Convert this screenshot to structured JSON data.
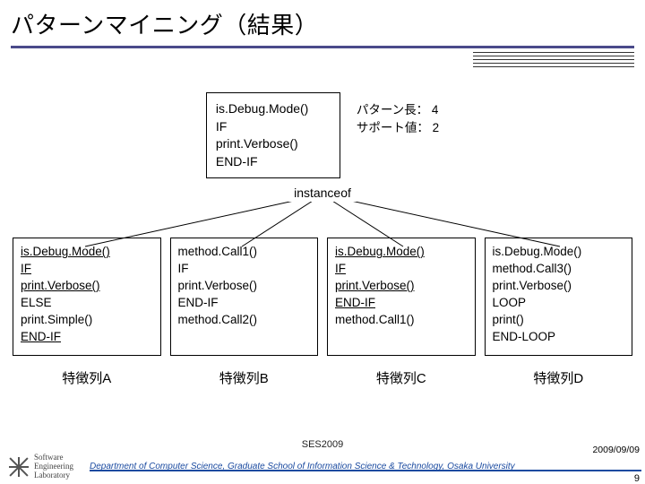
{
  "title": "パターンマイニング（結果）",
  "pattern_box": {
    "l1": "is.Debug.Mode()",
    "l2": "IF",
    "l3": "print.Verbose()",
    "l4": "END-IF"
  },
  "pattern_meta": {
    "line1": "パターン長： 4",
    "line2": "サポート値： 2"
  },
  "instanceof_label": "instanceof",
  "cols": {
    "A": {
      "label": "特徴列A",
      "l1": "is.Debug.Mode()",
      "l2": "IF",
      "l3": "print.Verbose()",
      "l4": "ELSE",
      "l5": "print.Simple()",
      "l6": "END-IF"
    },
    "B": {
      "label": "特徴列B",
      "l1": "method.Call1()",
      "l2": "IF",
      "l3": "print.Verbose()",
      "l4": "END-IF",
      "l5": "method.Call2()"
    },
    "C": {
      "label": "特徴列C",
      "l1": "is.Debug.Mode()",
      "l2": "IF",
      "l3": "print.Verbose()",
      "l4": "END-IF",
      "l5": "method.Call1()"
    },
    "D": {
      "label": "特徴列D",
      "l1": "is.Debug.Mode()",
      "l2": "method.Call3()",
      "l3": "print.Verbose()",
      "l4": "LOOP",
      "l5": "print()",
      "l6": "END-LOOP"
    }
  },
  "footer": {
    "conference": "SES2009",
    "date": "2009/09/09",
    "dept": "Department of Computer Science, Graduate School of Information Science & Technology, Osaka University",
    "page": "9",
    "logo_text_l1": "Software",
    "logo_text_l2": "Engineering",
    "logo_text_l3": "Laboratory"
  }
}
